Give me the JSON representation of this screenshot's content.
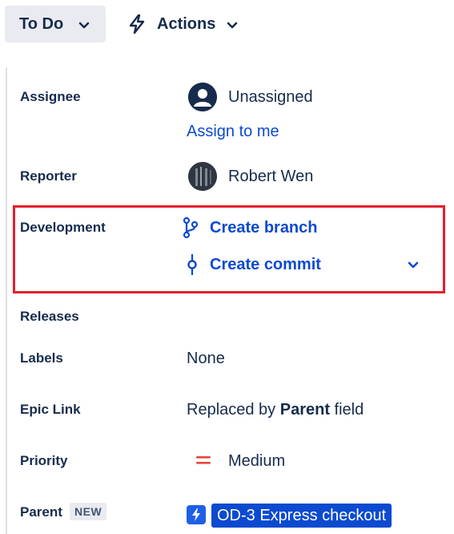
{
  "toolbar": {
    "status_label": "To Do",
    "actions_label": "Actions"
  },
  "fields": {
    "assignee": {
      "label": "Assignee",
      "value": "Unassigned",
      "assign_link": "Assign to me",
      "avatar_icon": "person-icon"
    },
    "reporter": {
      "label": "Reporter",
      "value": "Robert Wen"
    },
    "development": {
      "label": "Development",
      "create_branch": "Create branch",
      "create_commit": "Create commit",
      "branch_icon": "git-branch-icon",
      "commit_icon": "git-commit-icon"
    },
    "releases": {
      "label": "Releases"
    },
    "labels": {
      "label": "Labels",
      "value": "None"
    },
    "epic_link": {
      "label": "Epic Link",
      "value_prefix": "Replaced by ",
      "value_bold": "Parent",
      "value_suffix": " field"
    },
    "priority": {
      "label": "Priority",
      "value": "Medium",
      "icon": "priority-medium-icon"
    },
    "parent": {
      "label": "Parent",
      "badge": "NEW",
      "value": "OD-3 Express checkout",
      "icon": "epic-icon"
    }
  },
  "colors": {
    "link": "#0c4ad0",
    "highlight": "#e5202b",
    "priority": "#e5493a"
  }
}
